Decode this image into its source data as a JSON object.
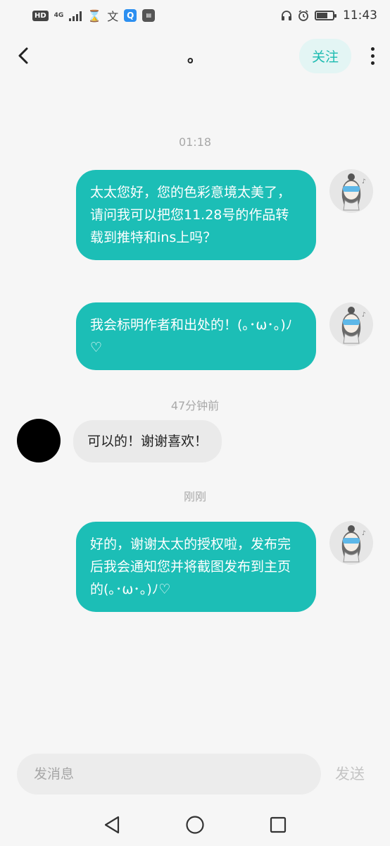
{
  "status_bar": {
    "hd_label": "HD",
    "network_label": "4G",
    "icons": [
      "hd-icon",
      "signal-icon",
      "hourglass-icon",
      "translate-icon",
      "search-app-icon",
      "app-icon",
      "headphones-icon",
      "alarm-icon",
      "battery-icon"
    ],
    "battery_level": 0.7,
    "time": "11:43"
  },
  "header": {
    "title": "。",
    "follow_label": "关注"
  },
  "messages": [
    {
      "type": "timestamp",
      "text": "01:18"
    },
    {
      "type": "outgoing",
      "text": "太太您好，您的色彩意境太美了，请问我可以把您11.28号的作品转载到推特和ins上吗？"
    },
    {
      "type": "outgoing",
      "text": "我会标明作者和出处的！(｡･ω･｡)ﾉ♡"
    },
    {
      "type": "timestamp",
      "text": "47分钟前"
    },
    {
      "type": "incoming",
      "text": "可以的！谢谢喜欢！"
    },
    {
      "type": "timestamp",
      "text": "刚刚"
    },
    {
      "type": "outgoing",
      "text": "好的，谢谢太太的授权啦，发布完后我会通知您并将截图发布到主页的(｡･ω･｡)ﾉ♡"
    }
  ],
  "input": {
    "placeholder": "发消息",
    "value": "",
    "send_label": "发送"
  },
  "colors": {
    "accent": "#1cbeb6",
    "follow_bg": "#e3f5f4",
    "incoming_bubble": "#eaeaea",
    "background": "#f6f6f6"
  },
  "nav": {
    "icons": [
      "back-triangle-icon",
      "home-circle-icon",
      "recents-square-icon"
    ]
  }
}
